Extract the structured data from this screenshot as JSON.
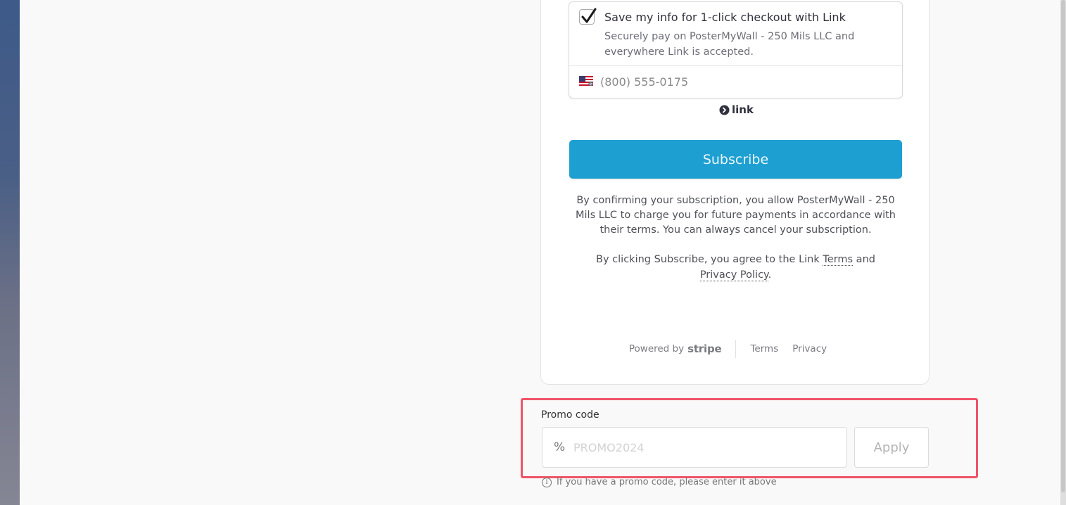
{
  "link_checkout": {
    "checkbox_checked": true,
    "save_title": "Save my info for 1-click checkout with Link",
    "save_description": "Securely pay on PosterMyWall - 250 Mils LLC and everywhere Link is accepted.",
    "phone_placeholder": "(800) 555-0175",
    "flag_icon": "us-flag-icon",
    "brand_label": "link"
  },
  "subscribe": {
    "button_label": "Subscribe",
    "button_color": "#1e9fd1"
  },
  "legal": {
    "subscription_notice": "By confirming your subscription, you allow PosterMyWall - 250 Mils LLC to charge you for future payments in accordance with their terms. You can always cancel your subscription.",
    "link_prefix": "By clicking Subscribe, you agree to the Link ",
    "link_terms": "Terms",
    "link_and": " and ",
    "link_privacy": "Privacy Policy",
    "link_suffix": "."
  },
  "footer": {
    "powered_by": "Powered by",
    "stripe": "stripe",
    "terms": "Terms",
    "privacy": "Privacy"
  },
  "promo": {
    "label": "Promo code",
    "icon": "%",
    "placeholder": "PROMO2024",
    "apply_label": "Apply",
    "help_icon": "i",
    "help_text": "If you have a promo code, please enter it above",
    "highlight_color": "#f05468"
  }
}
